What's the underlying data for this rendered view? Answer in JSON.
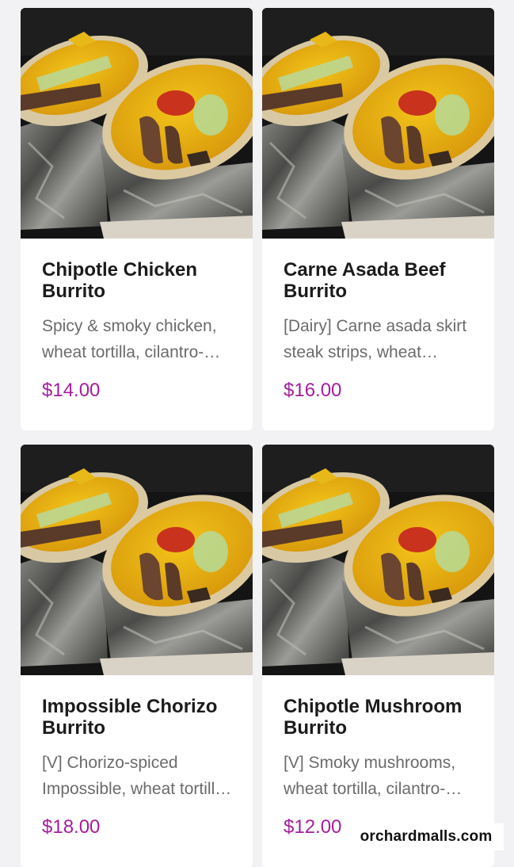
{
  "menu": {
    "items": [
      {
        "name": "Chipotle Chicken Burrito",
        "description": "Spicy & smoky chicken, wheat tortilla, cilantro-lime rice, black beans, salsa, lettuce",
        "price": "$14.00"
      },
      {
        "name": "Carne Asada Beef Burrito",
        "description": "[Dairy] Carne asada skirt steak strips, wheat tortilla, cilantro-lime rice, salsa",
        "price": "$16.00"
      },
      {
        "name": "Impossible Chorizo Burrito",
        "description": "[V] Chorizo-spiced Impossible, wheat tortilla, cilantro-lime rice, salsa",
        "price": "$18.00"
      },
      {
        "name": "Chipotle Mushroom Burrito",
        "description": "[V] Smoky mushrooms, wheat tortilla, cilantro-lime rice, salsa",
        "price": "$12.00"
      }
    ]
  },
  "watermark": {
    "text": "orchardmalls.com"
  },
  "colors": {
    "price": "#a51d9e",
    "background": "#f2f2f4"
  }
}
